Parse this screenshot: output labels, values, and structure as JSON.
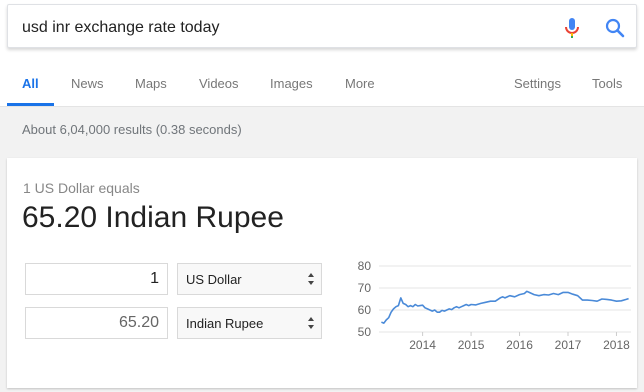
{
  "search": {
    "query": "usd inr exchange rate today"
  },
  "tabs": [
    {
      "label": "All",
      "active": true
    },
    {
      "label": "News"
    },
    {
      "label": "Maps"
    },
    {
      "label": "Videos"
    },
    {
      "label": "Images"
    },
    {
      "label": "More"
    },
    {
      "label": "Settings"
    },
    {
      "label": "Tools"
    }
  ],
  "results_stats": "About 6,04,000 results (0.38 seconds)",
  "converter": {
    "subtitle": "1 US Dollar equals",
    "result": "65.20 Indian Rupee",
    "from_amount": "1",
    "from_currency": "US Dollar",
    "to_amount": "65.20",
    "to_currency": "Indian Rupee"
  },
  "colors": {
    "accent": "#1a73e8",
    "line": "#4a8ad8"
  },
  "chart_data": {
    "type": "line",
    "xlabel": "",
    "ylabel": "",
    "xlim": [
      2013.1,
      2018.3
    ],
    "ylim": [
      50,
      80
    ],
    "y_ticks": [
      50,
      60,
      70,
      80
    ],
    "x_ticks": [
      "2014",
      "2015",
      "2016",
      "2017",
      "2018"
    ],
    "x_tick_values": [
      2014,
      2015,
      2016,
      2017,
      2018
    ],
    "grid": true,
    "series": [
      {
        "x": [
          2013.15,
          2013.2,
          2013.25,
          2013.3,
          2013.35,
          2013.4,
          2013.45,
          2013.5,
          2013.55,
          2013.6,
          2013.65,
          2013.7,
          2013.75,
          2013.8,
          2013.85,
          2013.9,
          2013.95,
          2014.0,
          2014.05,
          2014.1,
          2014.15,
          2014.2,
          2014.25,
          2014.3,
          2014.35,
          2014.4,
          2014.45,
          2014.5,
          2014.55,
          2014.6,
          2014.65,
          2014.7,
          2014.75,
          2014.8,
          2014.85,
          2014.9,
          2014.95,
          2015.0,
          2015.1,
          2015.2,
          2015.3,
          2015.4,
          2015.5,
          2015.6,
          2015.65,
          2015.7,
          2015.8,
          2015.9,
          2016.0,
          2016.1,
          2016.15,
          2016.2,
          2016.3,
          2016.4,
          2016.5,
          2016.6,
          2016.7,
          2016.8,
          2016.9,
          2017.0,
          2017.1,
          2017.2,
          2017.3,
          2017.4,
          2017.5,
          2017.6,
          2017.7,
          2017.8,
          2017.9,
          2018.0,
          2018.1,
          2018.2,
          2018.25
        ],
        "y": [
          54.5,
          54.0,
          55.5,
          56.5,
          59.0,
          60.5,
          61.5,
          62.0,
          65.5,
          63.0,
          62.5,
          61.5,
          62.0,
          61.5,
          62.5,
          61.8,
          62.0,
          62.2,
          61.0,
          60.5,
          60.0,
          59.5,
          60.0,
          59.0,
          59.0,
          59.8,
          59.5,
          60.0,
          60.5,
          60.2,
          61.0,
          61.5,
          61.0,
          61.5,
          62.0,
          62.5,
          62.0,
          62.5,
          62.3,
          63.0,
          63.5,
          64.0,
          64.0,
          65.5,
          66.0,
          65.5,
          66.5,
          66.0,
          67.0,
          67.5,
          68.5,
          68.0,
          67.0,
          66.5,
          67.0,
          66.8,
          67.5,
          67.0,
          68.0,
          68.0,
          67.2,
          66.5,
          64.5,
          64.5,
          64.3,
          64.0,
          65.0,
          64.8,
          64.5,
          64.0,
          64.2,
          64.8,
          65.2
        ]
      }
    ]
  }
}
